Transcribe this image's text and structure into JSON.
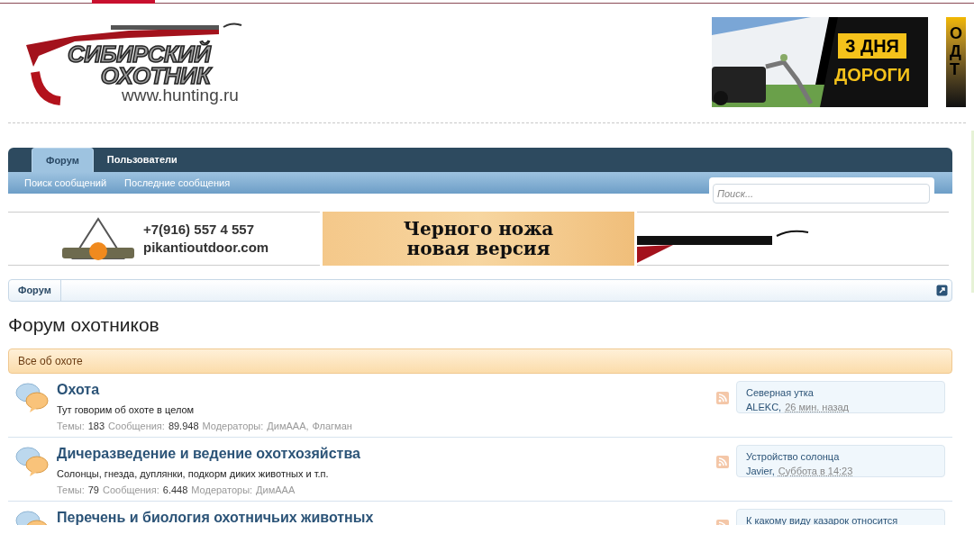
{
  "logo": {
    "line_1": "СИБИРСКИЙ",
    "line_2": "ОХОТНИК",
    "url": "www.hunting.ru"
  },
  "header_ads": [
    {
      "lines": [
        "3 ДНЯ",
        "ДОРОГИ"
      ]
    },
    {
      "lines": [
        "О",
        "Д",
        "Т"
      ]
    }
  ],
  "nav": {
    "tabs": [
      {
        "label": "Форум",
        "selected": true
      },
      {
        "label": "Пользователи",
        "selected": false
      }
    ],
    "sub_links": [
      "Поиск сообщений",
      "Последние сообщения"
    ],
    "search": {
      "placeholder": "Поиск..."
    }
  },
  "banners": {
    "phone": "+7(916) 557 4 557",
    "site": "pikantioutdoor.com",
    "knife_lines": [
      "Черного ножа",
      "новая версия"
    ]
  },
  "breadcrumb": [
    "Форум"
  ],
  "page_title": "Форум охотников",
  "category": {
    "title": "Все об охоте",
    "forums": [
      {
        "title": "Охота",
        "description": "Тут говорим об охоте в целом",
        "threads_label": "Темы:",
        "threads": "183",
        "posts_label": "Сообщения:",
        "posts": "89.948",
        "moderators_label": "Модераторы:",
        "moderators": [
          "ДимAAA,",
          "Флагман"
        ],
        "last_post": {
          "title": "Северная утка",
          "author": "ALEKC,",
          "time": "26 мин. назад"
        }
      },
      {
        "title": "Дичеразведение и ведение охотхозяйства",
        "description": "Солонцы, гнезда, дуплянки, подкорм диких животных и т.п.",
        "threads_label": "Темы:",
        "threads": "79",
        "posts_label": "Сообщения:",
        "posts": "6.448",
        "moderators_label": "Модераторы:",
        "moderators": [
          "ДимAAA"
        ],
        "last_post": {
          "title": "Устройство солонца",
          "author": "Javier,",
          "time": "Суббота в 14:23"
        }
      },
      {
        "title": "Перечень и биология охотничьих животных",
        "last_post": {
          "title": "К какому виду казарок относится"
        }
      }
    ]
  }
}
